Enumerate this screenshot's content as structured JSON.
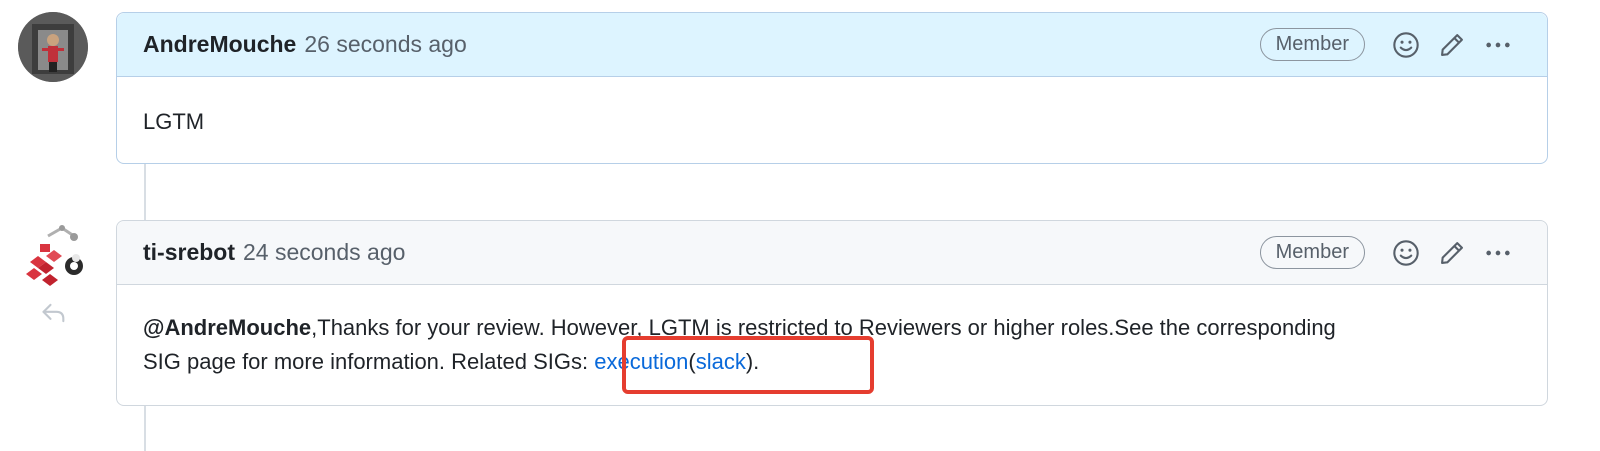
{
  "comments": [
    {
      "author": "AndreMouche",
      "timestamp": "26 seconds ago",
      "badge": "Member",
      "body": "LGTM"
    },
    {
      "author": "ti-srebot",
      "timestamp": "24 seconds ago",
      "badge": "Member",
      "body": {
        "mention": "@AndreMouche",
        "text_line1": ",Thanks for your review. However, LGTM is restricted to Reviewers or higher roles.See the corresponding",
        "text_line2": "SIG page for more information. Related SIGs: ",
        "link1": "execution",
        "paren_open": "(",
        "link2": "slack",
        "paren_close": ")."
      }
    }
  ],
  "icons": {
    "reaction": "smiley-icon",
    "edit": "pencil-icon",
    "more": "kebab-horizontal-icon",
    "reply": "reply-icon"
  },
  "colors": {
    "link": "#0969da",
    "highlight": "#e53d2f",
    "header_highlight": "#ddf4ff"
  }
}
